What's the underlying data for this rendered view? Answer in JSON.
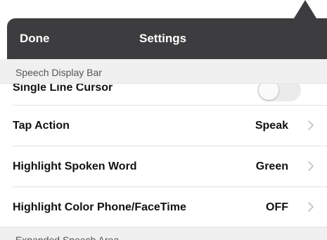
{
  "header": {
    "done_label": "Done",
    "title": "Settings"
  },
  "sections": {
    "speech_display_bar": "Speech Display Bar",
    "expanded_speech_area": "Expanded Speech Area"
  },
  "partial_row": {
    "label": "Single Line Cursor",
    "toggle_on": false
  },
  "rows": [
    {
      "label": "Tap Action",
      "value": "Speak"
    },
    {
      "label": "Highlight Spoken Word",
      "value": "Green"
    },
    {
      "label": "Highlight Color Phone/FaceTime",
      "value": "OFF"
    }
  ],
  "icons": {
    "chevron": "chevron-right-icon",
    "popover_arrow": "popover-arrow"
  },
  "colors": {
    "header_bg": "#3d3d3f",
    "section_bg": "#f0f0f0",
    "chevron": "#c4c4c8"
  }
}
